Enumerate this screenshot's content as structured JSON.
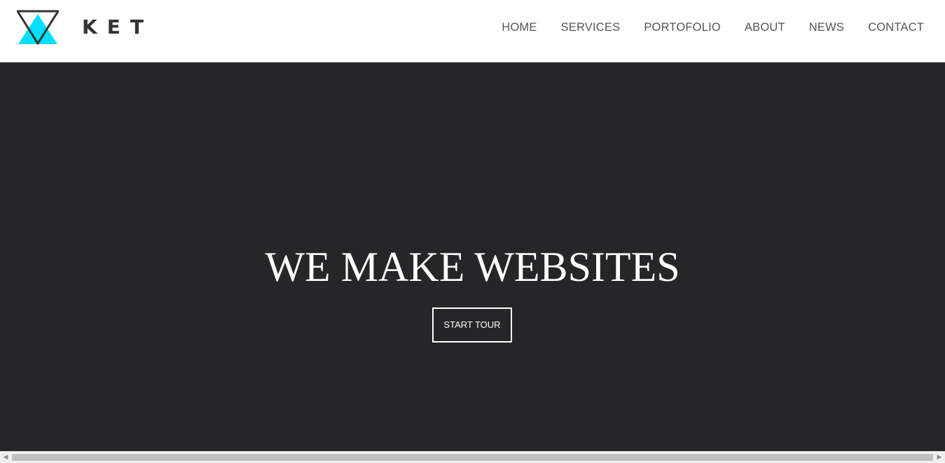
{
  "brand": {
    "name": "KET",
    "colors": {
      "accent": "#00e1ff",
      "outline": "#333333"
    }
  },
  "nav": {
    "items": [
      {
        "label": "HOME"
      },
      {
        "label": "SERVICES"
      },
      {
        "label": "PORTOFOLIO"
      },
      {
        "label": "ABOUT"
      },
      {
        "label": "NEWS"
      },
      {
        "label": "CONTACT"
      }
    ]
  },
  "hero": {
    "title": "WE MAKE WEBSITES",
    "button_label": "START TOUR",
    "background": "#252627"
  },
  "scrollbar": {
    "left_arrow_icon": "arrow-left-icon",
    "right_arrow_icon": "arrow-right-icon"
  }
}
